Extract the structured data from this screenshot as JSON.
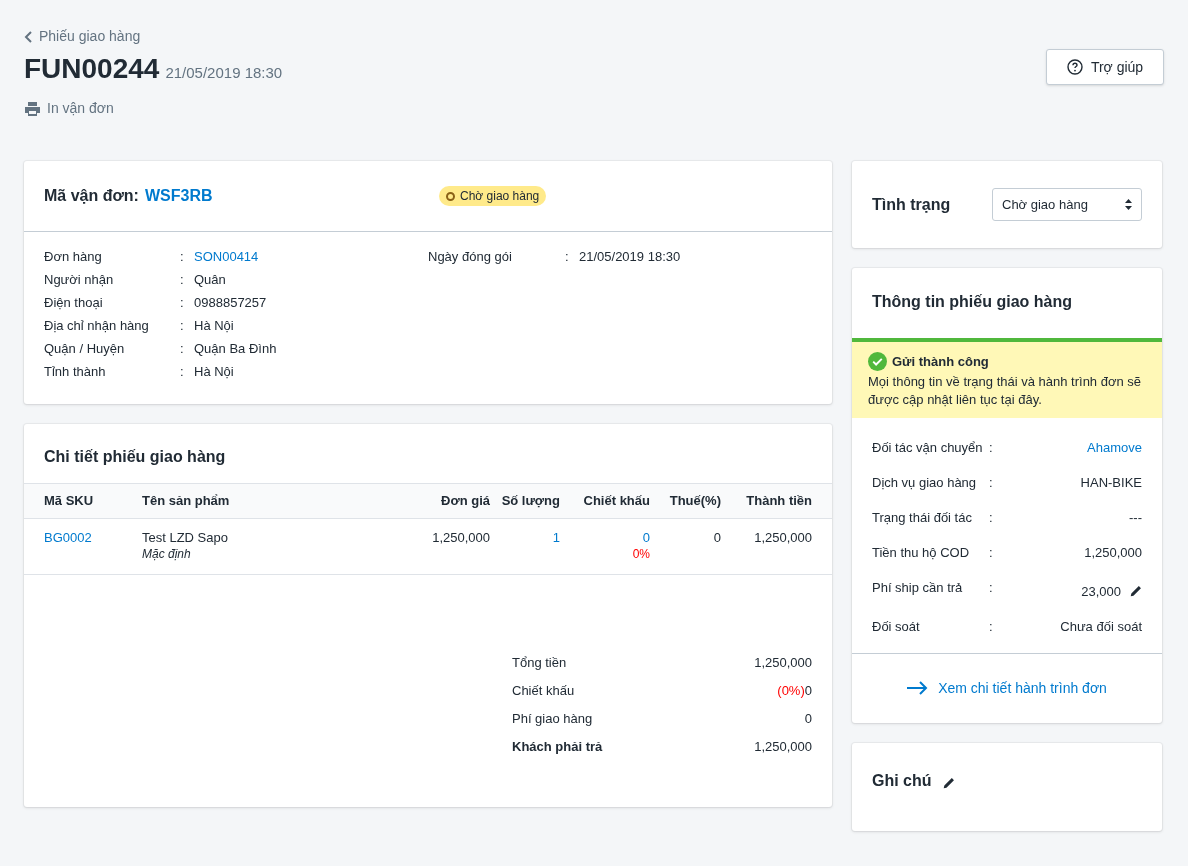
{
  "header": {
    "back": "Phiếu giao hàng",
    "code": "FUN00244",
    "date": "21/05/2019 18:30",
    "print": "In vận đơn",
    "help": "Trợ giúp"
  },
  "shipment": {
    "label": "Mã vận đơn:",
    "code": "WSF3RB",
    "status": "Chờ giao hàng",
    "left_fields": [
      {
        "label": "Đơn hàng",
        "sep": ":",
        "value": "SON00414",
        "link": true
      },
      {
        "label": "Người nhận",
        "sep": ":",
        "value": "Quân",
        "link": false
      },
      {
        "label": "Điện thoại",
        "sep": ":",
        "value": "0988857257",
        "link": false
      },
      {
        "label": "Địa chỉ nhận hàng",
        "sep": ":",
        "value": "Hà Nội",
        "link": false
      },
      {
        "label": "Quận / Huyện",
        "sep": ":",
        "value": "Quận Ba Đình",
        "link": false
      },
      {
        "label": "Tỉnh thành",
        "sep": ":",
        "value": "Hà Nội",
        "link": false
      }
    ],
    "right_fields": [
      {
        "label": "Ngày đóng gói",
        "sep": ":",
        "value": "21/05/2019 18:30",
        "link": false
      }
    ]
  },
  "details": {
    "title": "Chi tiết phiếu giao hàng",
    "columns": [
      "Mã SKU",
      "Tên sản phẩm",
      "Đơn giá",
      "Số lượng",
      "Chiết khấu",
      "Thuế(%)",
      "Thành tiền"
    ],
    "rows": [
      {
        "sku": "BG0002",
        "name": "Test LZD Sapo",
        "variant": "Mặc định",
        "price": "1,250,000",
        "qty": "1",
        "discount": "0",
        "discount_pct": "0%",
        "tax": "0",
        "total": "1,250,000"
      }
    ],
    "summary": [
      {
        "label": "Tổng tiền",
        "value": "1,250,000",
        "bold": false
      },
      {
        "label": "Chiết khấu",
        "note": "(0%)",
        "value": "0",
        "bold": false
      },
      {
        "label": "Phí giao hàng",
        "value": "0",
        "bold": false
      },
      {
        "label": "Khách phải trả",
        "value": "1,250,000",
        "bold": true
      }
    ]
  },
  "status_card": {
    "label": "Tình trạng",
    "value": "Chờ giao hàng"
  },
  "info_card": {
    "title": "Thông tin phiếu giao hàng",
    "alert_title": "Gửi thành công",
    "alert_text": "Mọi thông tin về trạng thái và hành trình đơn sẽ được cập nhật liên tục tại đây.",
    "rows": [
      {
        "label": "Đối tác vận chuyển",
        "sep": ":",
        "value": "Ahamove",
        "link": true,
        "editable": false
      },
      {
        "label": "Dịch vụ giao hàng",
        "sep": ":",
        "value": "HAN-BIKE",
        "link": false,
        "editable": false
      },
      {
        "label": "Trạng thái đối tác",
        "sep": ":",
        "value": "---",
        "link": false,
        "editable": false
      },
      {
        "label": "Tiền thu hộ COD",
        "sep": ":",
        "value": "1,250,000",
        "link": false,
        "editable": false
      },
      {
        "label": "Phí ship cần trả",
        "sep": ":",
        "value": "23,000",
        "link": false,
        "editable": true
      },
      {
        "label": "Đối soát",
        "sep": ":",
        "value": "Chưa đối soát",
        "link": false,
        "editable": false
      }
    ],
    "footer_link": "Xem chi tiết hành trình đơn"
  },
  "notes": {
    "title": "Ghi chú"
  }
}
